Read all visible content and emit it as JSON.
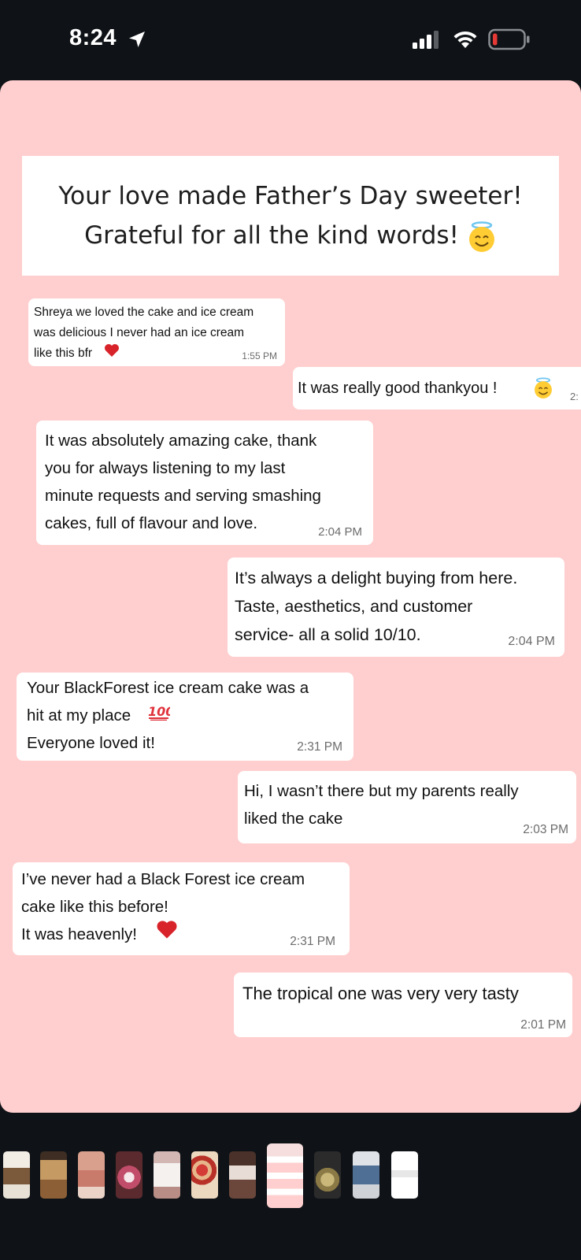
{
  "status_bar": {
    "time": "8:24",
    "icons": [
      "location-arrow-icon",
      "cellular-signal-icon",
      "wifi-icon",
      "battery-low-icon"
    ],
    "battery_color": "#e53935"
  },
  "story": {
    "background": "#ffcfcf",
    "banner": {
      "line1": "Your love made Father’s Day sweeter!",
      "line2": "Grateful for all the kind words!",
      "emoji": "smiling-face-with-halo-icon"
    },
    "messages": [
      {
        "text": "Shreya we loved the cake and ice cream\nwas delicious I never had an ice cream\nlike this bfr",
        "time": "1:55 PM",
        "emoji": "red-heart-icon"
      },
      {
        "text": "It was really good thankyou !",
        "time": "2:",
        "emoji": "smiling-face-with-halo-icon"
      },
      {
        "text": "It was absolutely amazing cake, thank\nyou for always listening to my last\nminute requests and serving smashing\ncakes, full of flavour and love.",
        "time": "2:04 PM"
      },
      {
        "text": "It’s always a delight buying from here.\nTaste, aesthetics, and customer\nservice- all a solid 10/10.",
        "time": "2:04 PM"
      },
      {
        "text": "Your BlackForest ice cream cake was a\nhit at my place\nEveryone loved it!",
        "time": "2:31 PM",
        "emoji": "hundred-points-icon"
      },
      {
        "text": "Hi, I wasn’t there but my parents really\nliked the cake",
        "time": "2:03 PM"
      },
      {
        "text": "I’ve never had a Black Forest ice cream\ncake like this before!\nIt was heavenly!",
        "time": "2:31 PM",
        "emoji": "red-heart-icon"
      },
      {
        "text": "The tropical one was very very tasty",
        "time": "2:01 PM"
      }
    ]
  },
  "thumbnails": {
    "count": 11,
    "active_index": 7,
    "items": [
      "story-thumbnail",
      "story-thumbnail",
      "story-thumbnail",
      "story-thumbnail",
      "story-thumbnail",
      "story-thumbnail",
      "story-thumbnail",
      "story-thumbnail",
      "story-thumbnail",
      "story-thumbnail",
      "story-thumbnail"
    ]
  }
}
